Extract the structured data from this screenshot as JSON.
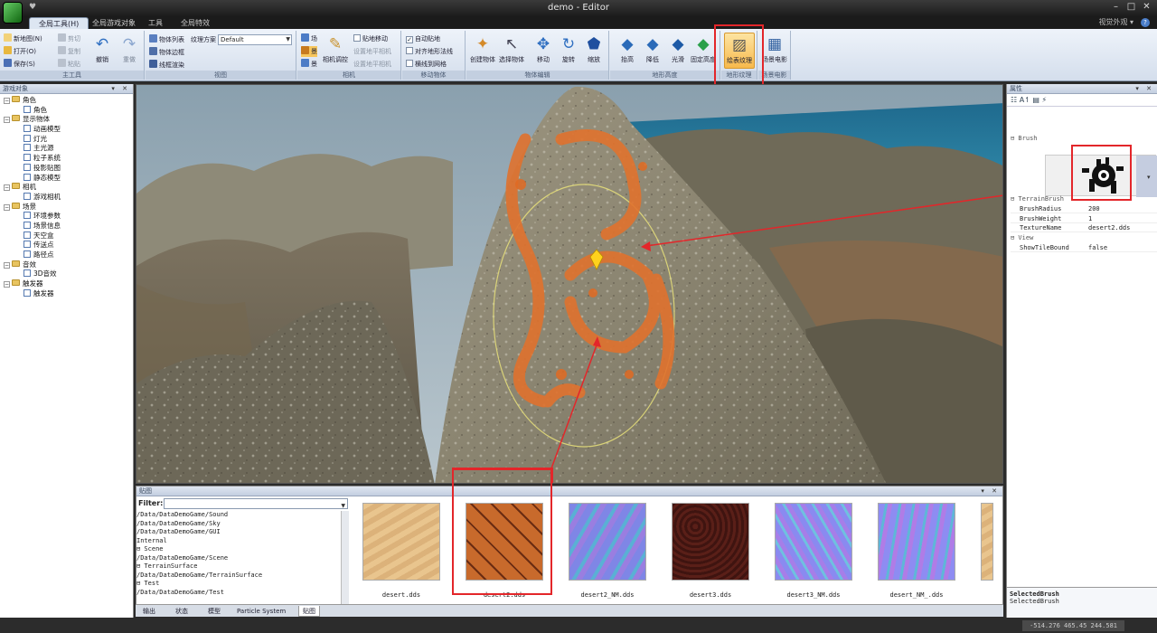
{
  "window": {
    "title": "demo - Editor",
    "quick_access": "♥"
  },
  "ribbon_tabs": [
    {
      "label": "全局工具(H)",
      "active": true
    },
    {
      "label": "全局游戏对象"
    },
    {
      "label": "工具"
    },
    {
      "label": "全局特效"
    }
  ],
  "skin_label": "视觉外观 ▾",
  "help": "?",
  "groups": {
    "main_tools": {
      "label": "主工具",
      "new_map": "新地图(N)",
      "open": "打开(O)",
      "save": "保存(S)",
      "cut": "剪切",
      "copy": "复制",
      "paste": "粘贴",
      "undo": "撤销",
      "redo": "重做"
    },
    "view": {
      "label": "视图",
      "object_list": "物体列表",
      "texture_scheme": "纹理方案",
      "scheme_value": "Default",
      "wireframe": "物体边框",
      "bbox_render": "线框渲染"
    },
    "camera": {
      "label": "相机",
      "item1": "场",
      "item2": "景",
      "item3": "景",
      "camera_lock": "相机调控",
      "ground_move": "贴地移动",
      "set_ground_camera": "设置地平相机",
      "set_default_camera": "设置地平相机"
    },
    "move_object": {
      "label": "移动物体",
      "auto_ground": "自动贴地",
      "keep_ground": "对齐地形法线",
      "show_grid": "横线到网格",
      "auto_ground_checked": true,
      "keep_ground_checked": false,
      "show_grid_checked": false
    },
    "object_editing": {
      "label": "物体编辑",
      "create": "创建物体",
      "select": "选择物体",
      "move": "移动",
      "rotate": "旋转",
      "scale": "缩放"
    },
    "terrain_height": {
      "label": "地形高度",
      "raise": "抬高",
      "lower": "降低",
      "smooth": "光滑",
      "set_height": "固定高度"
    },
    "terrain_texture": {
      "label": "地形纹理",
      "paint": "绘表纹理"
    },
    "tv": {
      "label": "场景电影",
      "film": "场景电影"
    }
  },
  "left_panel": {
    "title": "游戏对象",
    "tree": [
      {
        "label": "角色",
        "level": 0,
        "type": "folder"
      },
      {
        "label": "角色",
        "level": 1,
        "type": "leaf"
      },
      {
        "label": "显示物体",
        "level": 0,
        "type": "folder"
      },
      {
        "label": "动画模型",
        "level": 1,
        "type": "leaf"
      },
      {
        "label": "灯光",
        "level": 1,
        "type": "leaf"
      },
      {
        "label": "主光源",
        "level": 1,
        "type": "leaf"
      },
      {
        "label": "粒子系统",
        "level": 1,
        "type": "leaf"
      },
      {
        "label": "投影贴图",
        "level": 1,
        "type": "leaf"
      },
      {
        "label": "静态模型",
        "level": 1,
        "type": "leaf"
      },
      {
        "label": "相机",
        "level": 0,
        "type": "folder"
      },
      {
        "label": "游戏相机",
        "level": 1,
        "type": "leaf"
      },
      {
        "label": "场景",
        "level": 0,
        "type": "folder"
      },
      {
        "label": "环境参数",
        "level": 1,
        "type": "leaf"
      },
      {
        "label": "场景信息",
        "level": 1,
        "type": "leaf"
      },
      {
        "label": "天空盒",
        "level": 1,
        "type": "leaf"
      },
      {
        "label": "传送点",
        "level": 1,
        "type": "leaf"
      },
      {
        "label": "路径点",
        "level": 1,
        "type": "leaf"
      },
      {
        "label": "音效",
        "level": 0,
        "type": "folder"
      },
      {
        "label": "3D音效",
        "level": 1,
        "type": "leaf"
      },
      {
        "label": "触发器",
        "level": 0,
        "type": "folder"
      },
      {
        "label": "触发器",
        "level": 1,
        "type": "leaf"
      }
    ]
  },
  "texture_panel": {
    "title": "贴图",
    "filter_label": "Filter:",
    "paths": [
      "      /Data/DataDemoGame/Sound",
      "      /Data/DataDemoGame/Sky",
      "      /Data/DataDemoGame/GUI",
      "   Internal",
      "⊟ Scene",
      "      /Data/DataDemoGame/Scene",
      "⊟ TerrainSurface",
      "      /Data/DataDemoGame/TerrainSurface",
      "⊟ Test",
      "      /Data/DataDemoGame/Test"
    ],
    "textures": [
      {
        "name": "desert.dds",
        "kind": "sand"
      },
      {
        "name": "desert2.dds",
        "kind": "cracked"
      },
      {
        "name": "desert2_NM.dds",
        "kind": "normal1"
      },
      {
        "name": "desert3.dds",
        "kind": "dirt"
      },
      {
        "name": "desert3_NM.dds",
        "kind": "normal2"
      },
      {
        "name": "desert_NM_.dds",
        "kind": "normal3"
      }
    ]
  },
  "bottom_tabs": [
    {
      "label": "输出"
    },
    {
      "label": "状态"
    },
    {
      "label": "模型"
    },
    {
      "label": "Particle System"
    },
    {
      "label": "贴图",
      "active": true
    }
  ],
  "properties": {
    "title": "属性",
    "toolbar": "☷ A↿ ▤ ⚡",
    "brush_category": "⊟  Brush",
    "terrain_category": "⊟  TerrainBrush",
    "view_category": "⊟  View",
    "rows": [
      {
        "name": "BrushRadius",
        "value": "200"
      },
      {
        "name": "BrushWeight",
        "value": "1"
      },
      {
        "name": "TextureName",
        "value": "desert2.dds"
      }
    ],
    "view_rows": [
      {
        "name": "ShowTileBound",
        "value": "false"
      }
    ],
    "desc_title": "SelectedBrush",
    "desc_text": "SelectedBrush"
  },
  "status": {
    "coords": "-514.276 465.45 244.581"
  },
  "colors": {
    "highlight": "#e3262a",
    "ribbon_selected": "#f7b94c"
  }
}
